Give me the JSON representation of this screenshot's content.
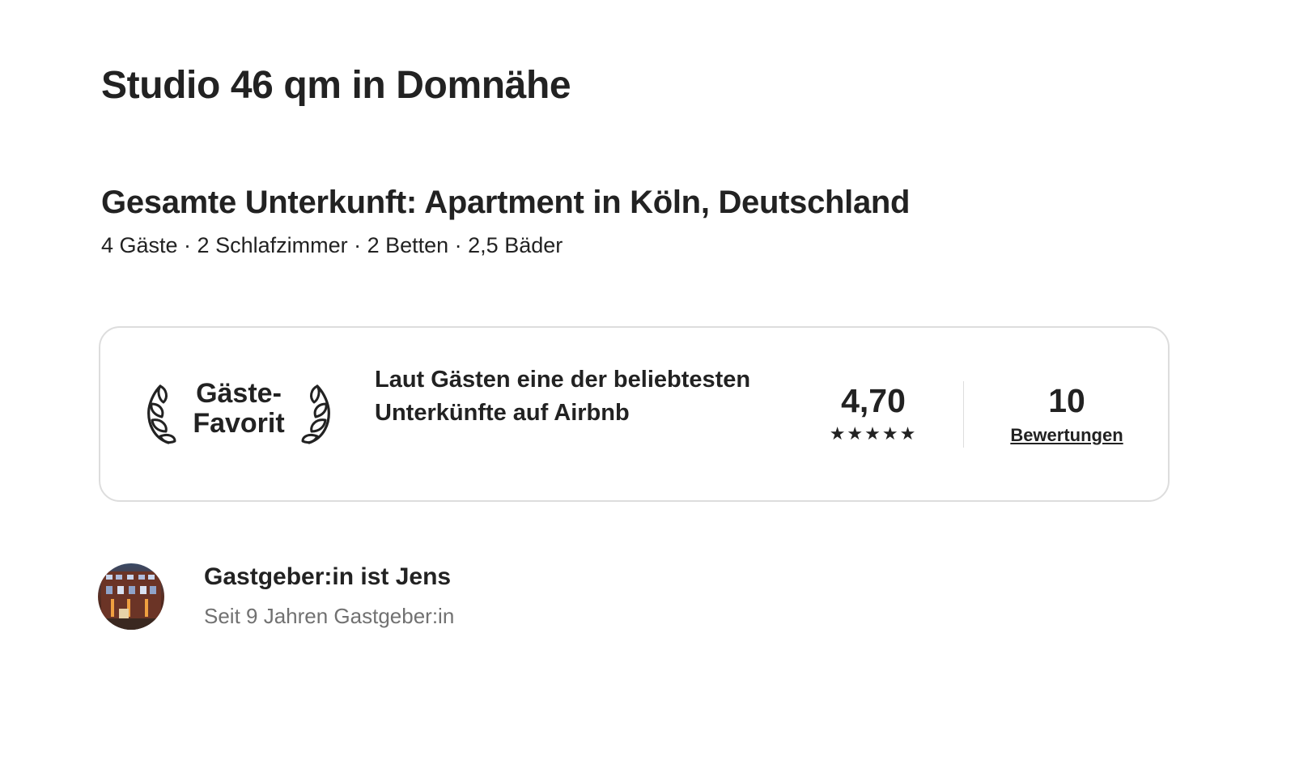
{
  "listing": {
    "title": "Studio 46 qm in Domnähe",
    "subtitle": "Gesamte Unterkunft: Apartment in Köln, Deutschland",
    "details": "4 Gäste · 2 Schlafzimmer · 2 Betten · 2,5 Bäder"
  },
  "guest_favorite": {
    "label": "Gäste-\nFavorit",
    "description": "Laut Gästen eine der beliebtesten Unterkünfte auf Airbnb",
    "rating": "4,70",
    "stars_icon": "five-stars-icon",
    "stars": "★★★★★",
    "stars_count": 5,
    "reviews_count": "10",
    "reviews_label": "Bewertungen"
  },
  "host": {
    "name": "Gastgeber:in ist Jens",
    "since": "Seit 9 Jahren Gastgeber:in",
    "avatar_icon": "host-avatar-photo"
  },
  "colors": {
    "text_primary": "#222222",
    "text_secondary": "#717171",
    "border": "#dddddd",
    "background": "#ffffff"
  }
}
